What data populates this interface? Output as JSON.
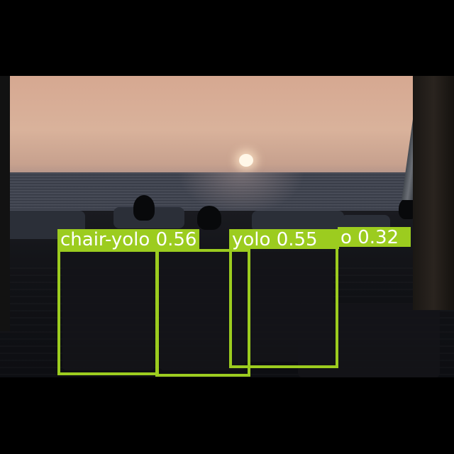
{
  "scene": {
    "description_colors": {
      "box_color": "#9ccc1f",
      "label_text_color": "#ffffff",
      "letterbox": "#000000"
    }
  },
  "detections": [
    {
      "label": "chair-yolo",
      "score": "0.56"
    },
    {
      "label": "chair-yolo",
      "score": "0.55"
    },
    {
      "label": "chair-yolo",
      "score": "0.32"
    }
  ],
  "labels": {
    "d0": "chair-yolo 0.56",
    "d1": "yolo 0.55",
    "d2": "o 0.32"
  }
}
